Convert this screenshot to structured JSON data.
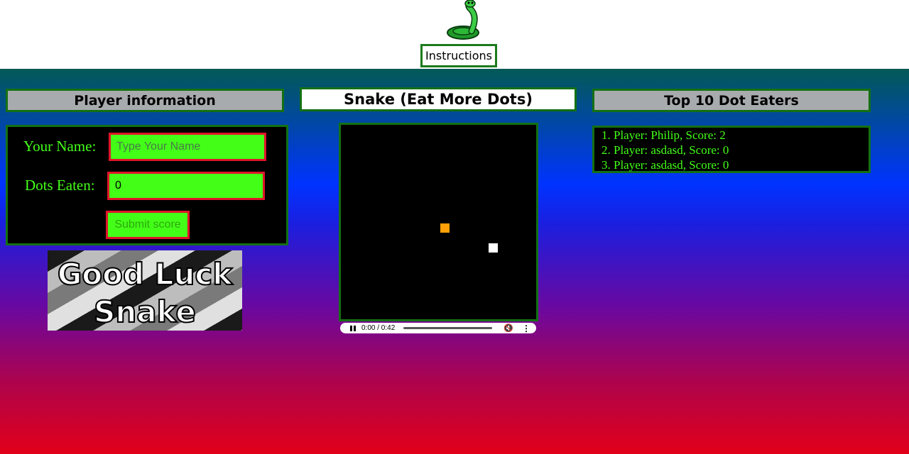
{
  "header": {
    "logo_icon": "snake-logo-icon",
    "instructions_label": "Instructions"
  },
  "player_panel": {
    "title": "Player information",
    "name_label": "Your Name:",
    "name_placeholder": "Type Your Name",
    "name_value": "",
    "dots_label": "Dots Eaten:",
    "dots_value": "0",
    "submit_label": "Submit score"
  },
  "banner": {
    "line1": "Good Luck",
    "line2": "Snake"
  },
  "game_panel": {
    "title": "Snake (Eat More Dots)",
    "food_color": "#ffa008",
    "snake_color": "#ffffff"
  },
  "audio": {
    "time": "0:00 / 0:42",
    "pause_icon": "pause-icon",
    "mute_icon": "muted-speaker-icon",
    "more_icon": "more-vertical-icon"
  },
  "scores_panel": {
    "title": "Top 10 Dot Eaters",
    "entries": [
      "1. Player: Philip, Score: 2",
      "2. Player: asdasd, Score: 0",
      "3. Player: asdasd, Score: 0"
    ]
  },
  "colors": {
    "accent_green": "#43ff18",
    "border_green": "#137013",
    "input_border_red": "#e0142a"
  }
}
